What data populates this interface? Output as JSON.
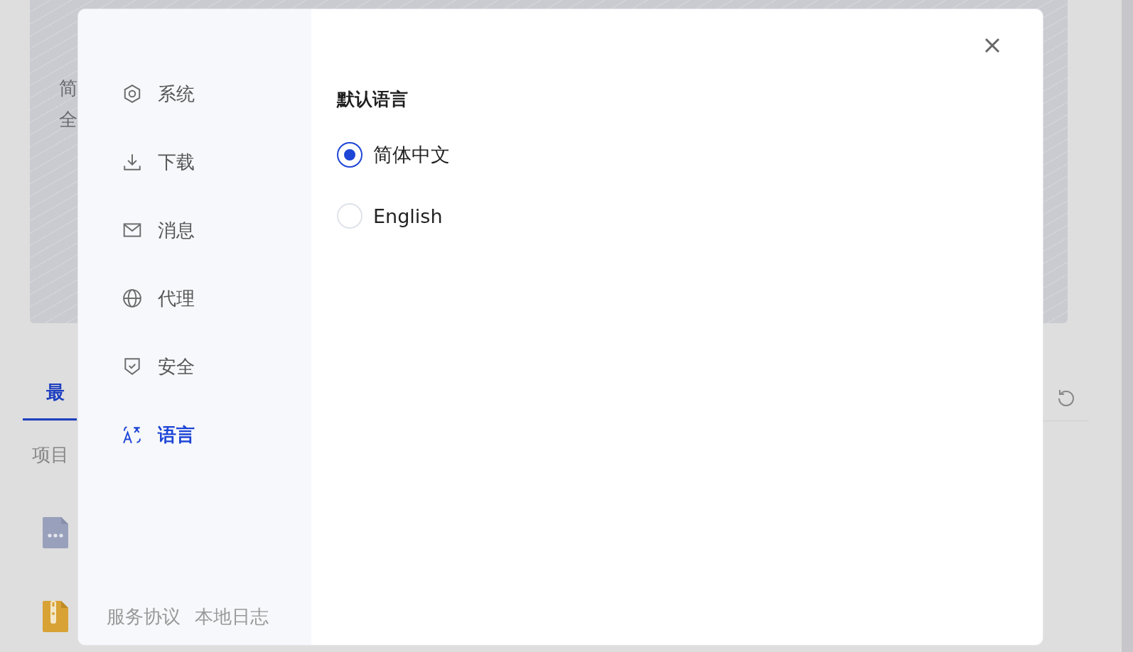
{
  "background": {
    "banner_lines": [
      "简",
      "全"
    ],
    "tabs": [
      {
        "label": "最",
        "selected": true
      }
    ],
    "column_header": "项目",
    "files": [
      {
        "kind": "other"
      },
      {
        "kind": "archive"
      }
    ]
  },
  "dialog": {
    "nav": [
      {
        "kind": "system",
        "label": "系统",
        "selected": false
      },
      {
        "kind": "download",
        "label": "下载",
        "selected": false
      },
      {
        "kind": "message",
        "label": "消息",
        "selected": false
      },
      {
        "kind": "proxy",
        "label": "代理",
        "selected": false
      },
      {
        "kind": "security",
        "label": "安全",
        "selected": false
      },
      {
        "kind": "language",
        "label": "语言",
        "selected": true
      }
    ],
    "footer_links": [
      "服务协议",
      "本地日志"
    ],
    "section_title": "默认语言",
    "options": [
      {
        "label": "简体中文",
        "selected": true
      },
      {
        "label": "English",
        "selected": false
      }
    ]
  }
}
